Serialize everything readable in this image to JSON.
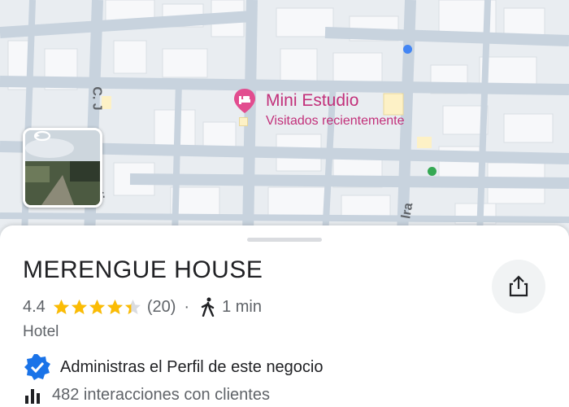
{
  "map": {
    "pin_title": "Mini Estudio",
    "pin_subtitle": "Visitados recientemente",
    "street_labels": [
      "C. J",
      "ti",
      "lra"
    ],
    "icons": {
      "pin": "bed-pin-icon",
      "street_view": "street-view-thumbnail",
      "rotate": "rotate-360-icon"
    },
    "colors": {
      "pin": "#c2307a",
      "blue_dot": "#4285f4",
      "green_dot": "#34a853"
    }
  },
  "place": {
    "name": "MERENGUE HOUSE",
    "rating": "4.4",
    "rating_value": 4.4,
    "stars_max": 5,
    "reviews": "(20)",
    "separator": "·",
    "walk_time": "1 min",
    "category": "Hotel",
    "verified_text": "Administras el Perfil de este negocio",
    "interactions": "482 interacciones con clientes",
    "icons": {
      "share": "share-icon",
      "walk": "walking-icon",
      "verified": "verified-badge-icon",
      "stats": "bar-chart-icon"
    },
    "colors": {
      "star": "#fbbc04",
      "verified": "#1a73e8"
    }
  }
}
